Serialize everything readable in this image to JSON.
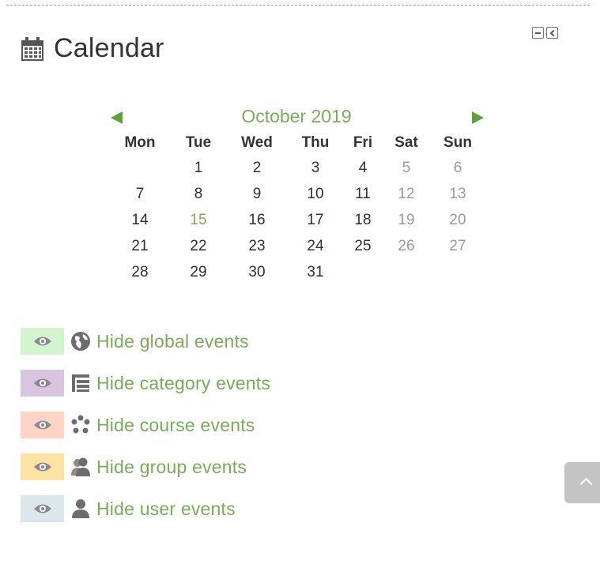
{
  "block": {
    "title": "Calendar",
    "controls": [
      "minimize-icon",
      "dock-icon"
    ]
  },
  "calendar": {
    "month_label": "October 2019",
    "weekdays": [
      "Mon",
      "Tue",
      "Wed",
      "Thu",
      "Fri",
      "Sat",
      "Sun"
    ],
    "weeks": [
      [
        "",
        "1",
        "2",
        "3",
        "4",
        "5",
        "6"
      ],
      [
        "7",
        "8",
        "9",
        "10",
        "11",
        "12",
        "13"
      ],
      [
        "14",
        "15",
        "16",
        "17",
        "18",
        "19",
        "20"
      ],
      [
        "21",
        "22",
        "23",
        "24",
        "25",
        "26",
        "27"
      ],
      [
        "28",
        "29",
        "30",
        "31",
        "",
        "",
        ""
      ]
    ],
    "today": "15"
  },
  "filters": [
    {
      "label": "Hide global events",
      "color": "#d2f5cf",
      "icon": "globe-icon"
    },
    {
      "label": "Hide category events",
      "color": "#d9c5e0",
      "icon": "category-icon"
    },
    {
      "label": "Hide course events",
      "color": "#ffd4c7",
      "icon": "course-icon"
    },
    {
      "label": "Hide group events",
      "color": "#fde3a3",
      "icon": "group-icon"
    },
    {
      "label": "Hide user events",
      "color": "#dbe7ea",
      "icon": "user-icon"
    }
  ],
  "colors": {
    "accent": "#77ad55",
    "nav_arrow": "#5aa33c",
    "weekend_text": "#9a9a9a"
  }
}
